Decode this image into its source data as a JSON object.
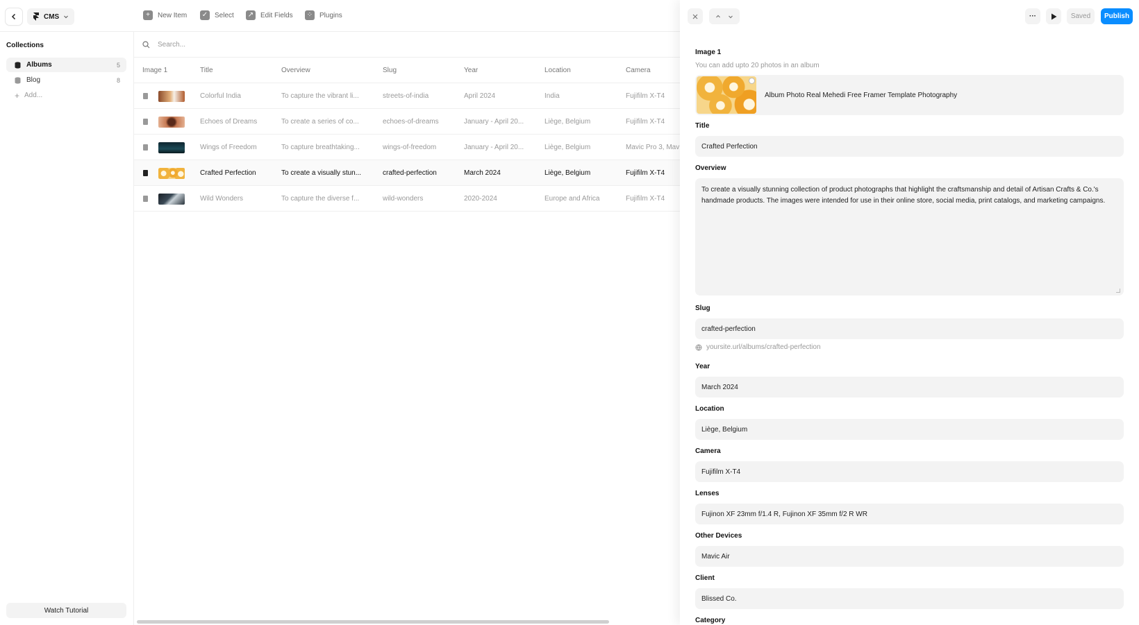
{
  "topbar": {
    "project_label": "CMS",
    "tools": [
      {
        "label": "New Item",
        "icon": "plus-icon"
      },
      {
        "label": "Select",
        "icon": "check-icon"
      },
      {
        "label": "Edit Fields",
        "icon": "arrow-up-right-icon"
      },
      {
        "label": "Plugins",
        "icon": "plugins-icon"
      }
    ]
  },
  "sidebar": {
    "heading": "Collections",
    "items": [
      {
        "label": "Albums",
        "count": "5"
      },
      {
        "label": "Blog",
        "count": "8"
      }
    ],
    "add_label": "Add...",
    "watch_label": "Watch Tutorial"
  },
  "search": {
    "placeholder": "Search..."
  },
  "table": {
    "columns": [
      "Image 1",
      "Title",
      "Overview",
      "Slug",
      "Year",
      "Location",
      "Camera"
    ],
    "rows": [
      {
        "title": "Colorful India",
        "overview": "To capture the vibrant li...",
        "slug": "streets-of-india",
        "year": "April 2024",
        "location": "India",
        "camera": "Fujifilm X-T4"
      },
      {
        "title": "Echoes of Dreams",
        "overview": "To create a series of co...",
        "slug": "echoes-of-dreams",
        "year": "January - April 20...",
        "location": "Liège, Belgium",
        "camera": "Fujifilm X-T4"
      },
      {
        "title": "Wings of Freedom",
        "overview": "To capture breathtaking...",
        "slug": "wings-of-freedom",
        "year": "January - April 20...",
        "location": "Liège, Belgium",
        "camera": "Mavic Pro 3, Mav"
      },
      {
        "title": "Crafted Perfection",
        "overview": "To create a visually stun...",
        "slug": "crafted-perfection",
        "year": "March 2024",
        "location": "Liège, Belgium",
        "camera": "Fujifilm X-T4"
      },
      {
        "title": "Wild Wonders",
        "overview": "To capture the diverse f...",
        "slug": "wild-wonders",
        "year": "2020-2024",
        "location": "Europe and Africa",
        "camera": "Fujifilm X-T4"
      }
    ]
  },
  "panel": {
    "saved_label": "Saved",
    "publish_label": "Publish",
    "image_label": "Image 1",
    "image_help": "You can add upto 20 photos in an album",
    "image_caption": "Album Photo Real Mehedi Free Framer Template Photography",
    "title_label": "Title",
    "title_value": "Crafted Perfection",
    "overview_label": "Overview",
    "overview_value": "To create a visually stunning collection of product photographs that highlight the craftsmanship and detail of Artisan Crafts & Co.'s handmade products. The images were intended for use in their online store, social media, print catalogs, and marketing campaigns.",
    "slug_label": "Slug",
    "slug_value": "crafted-perfection",
    "slug_url": "yoursite.url/albums/crafted-perfection",
    "year_label": "Year",
    "year_value": "March 2024",
    "location_label": "Location",
    "location_value": "Liège, Belgium",
    "camera_label": "Camera",
    "camera_value": "Fujifilm X-T4",
    "lenses_label": "Lenses",
    "lenses_value": "Fujinon XF 23mm f/1.4 R, Fujinon XF 35mm f/2 R WR",
    "other_label": "Other Devices",
    "other_value": "Mavic Air",
    "client_label": "Client",
    "client_value": "Blissed Co.",
    "category_label": "Category"
  },
  "colors": {
    "accent": "#0a8dff",
    "panel_bg": "#ffffff",
    "field_bg": "#f3f3f3"
  }
}
